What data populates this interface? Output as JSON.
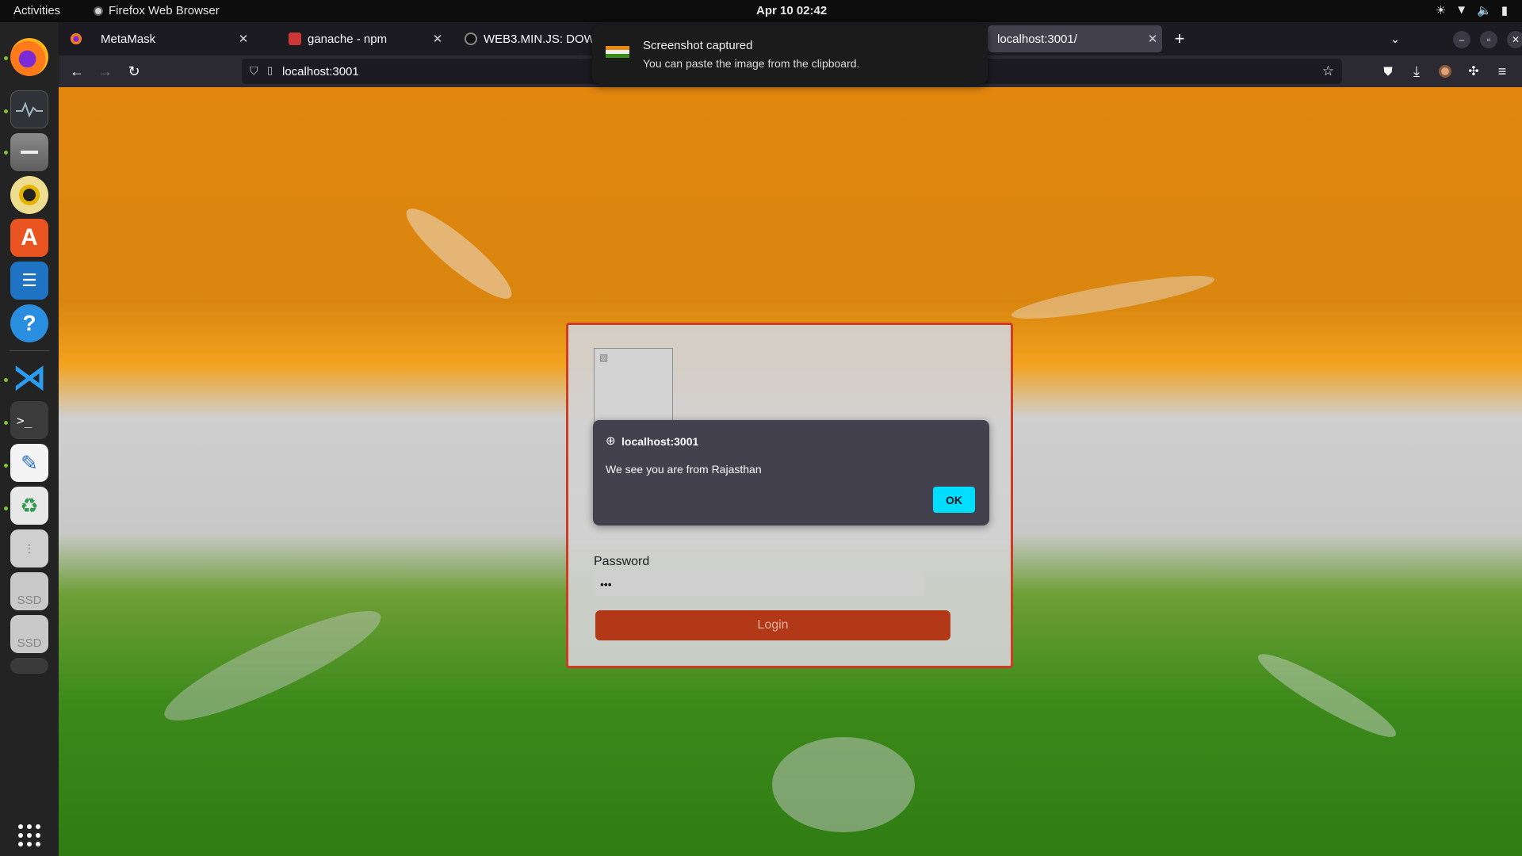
{
  "topbar": {
    "activities": "Activities",
    "app_name": "Firefox Web Browser",
    "clock": "Apr 10  02:42",
    "tray_icons": [
      "brightness-icon",
      "wifi-icon",
      "volume-icon",
      "battery-icon"
    ]
  },
  "dock": {
    "items": [
      "firefox",
      "system-monitor",
      "files",
      "rhythmbox",
      "app-center",
      "libreoffice-writer",
      "help",
      "vscode",
      "terminal",
      "text-editor",
      "trash",
      "disk",
      "ssd-drive",
      "ssd-drive",
      "show-apps"
    ],
    "ssd_label": "SSD"
  },
  "browser": {
    "tabs": [
      {
        "title": "MetaMask",
        "active": false
      },
      {
        "title": "ganache - npm",
        "active": false
      },
      {
        "title": "WEB3.MIN.JS: DOWNLOAD",
        "active": false
      },
      {
        "title": "localhost:3001/",
        "active": true
      }
    ],
    "new_tab": "+",
    "url": "localhost:3001"
  },
  "page": {
    "password_label": "Password",
    "password_value": "•••",
    "login_button": "Login"
  },
  "alert": {
    "origin": "localhost:3001",
    "message": "We see you are from Rajasthan",
    "ok": "OK"
  },
  "notification": {
    "title": "Screenshot captured",
    "body": "You can paste the image from the clipboard."
  },
  "colors": {
    "accent_ok": "#00ddff",
    "login_button": "#b33818",
    "panel_border": "#cf3c24",
    "saffron": "#e2860e",
    "green": "#3c8a1a"
  }
}
